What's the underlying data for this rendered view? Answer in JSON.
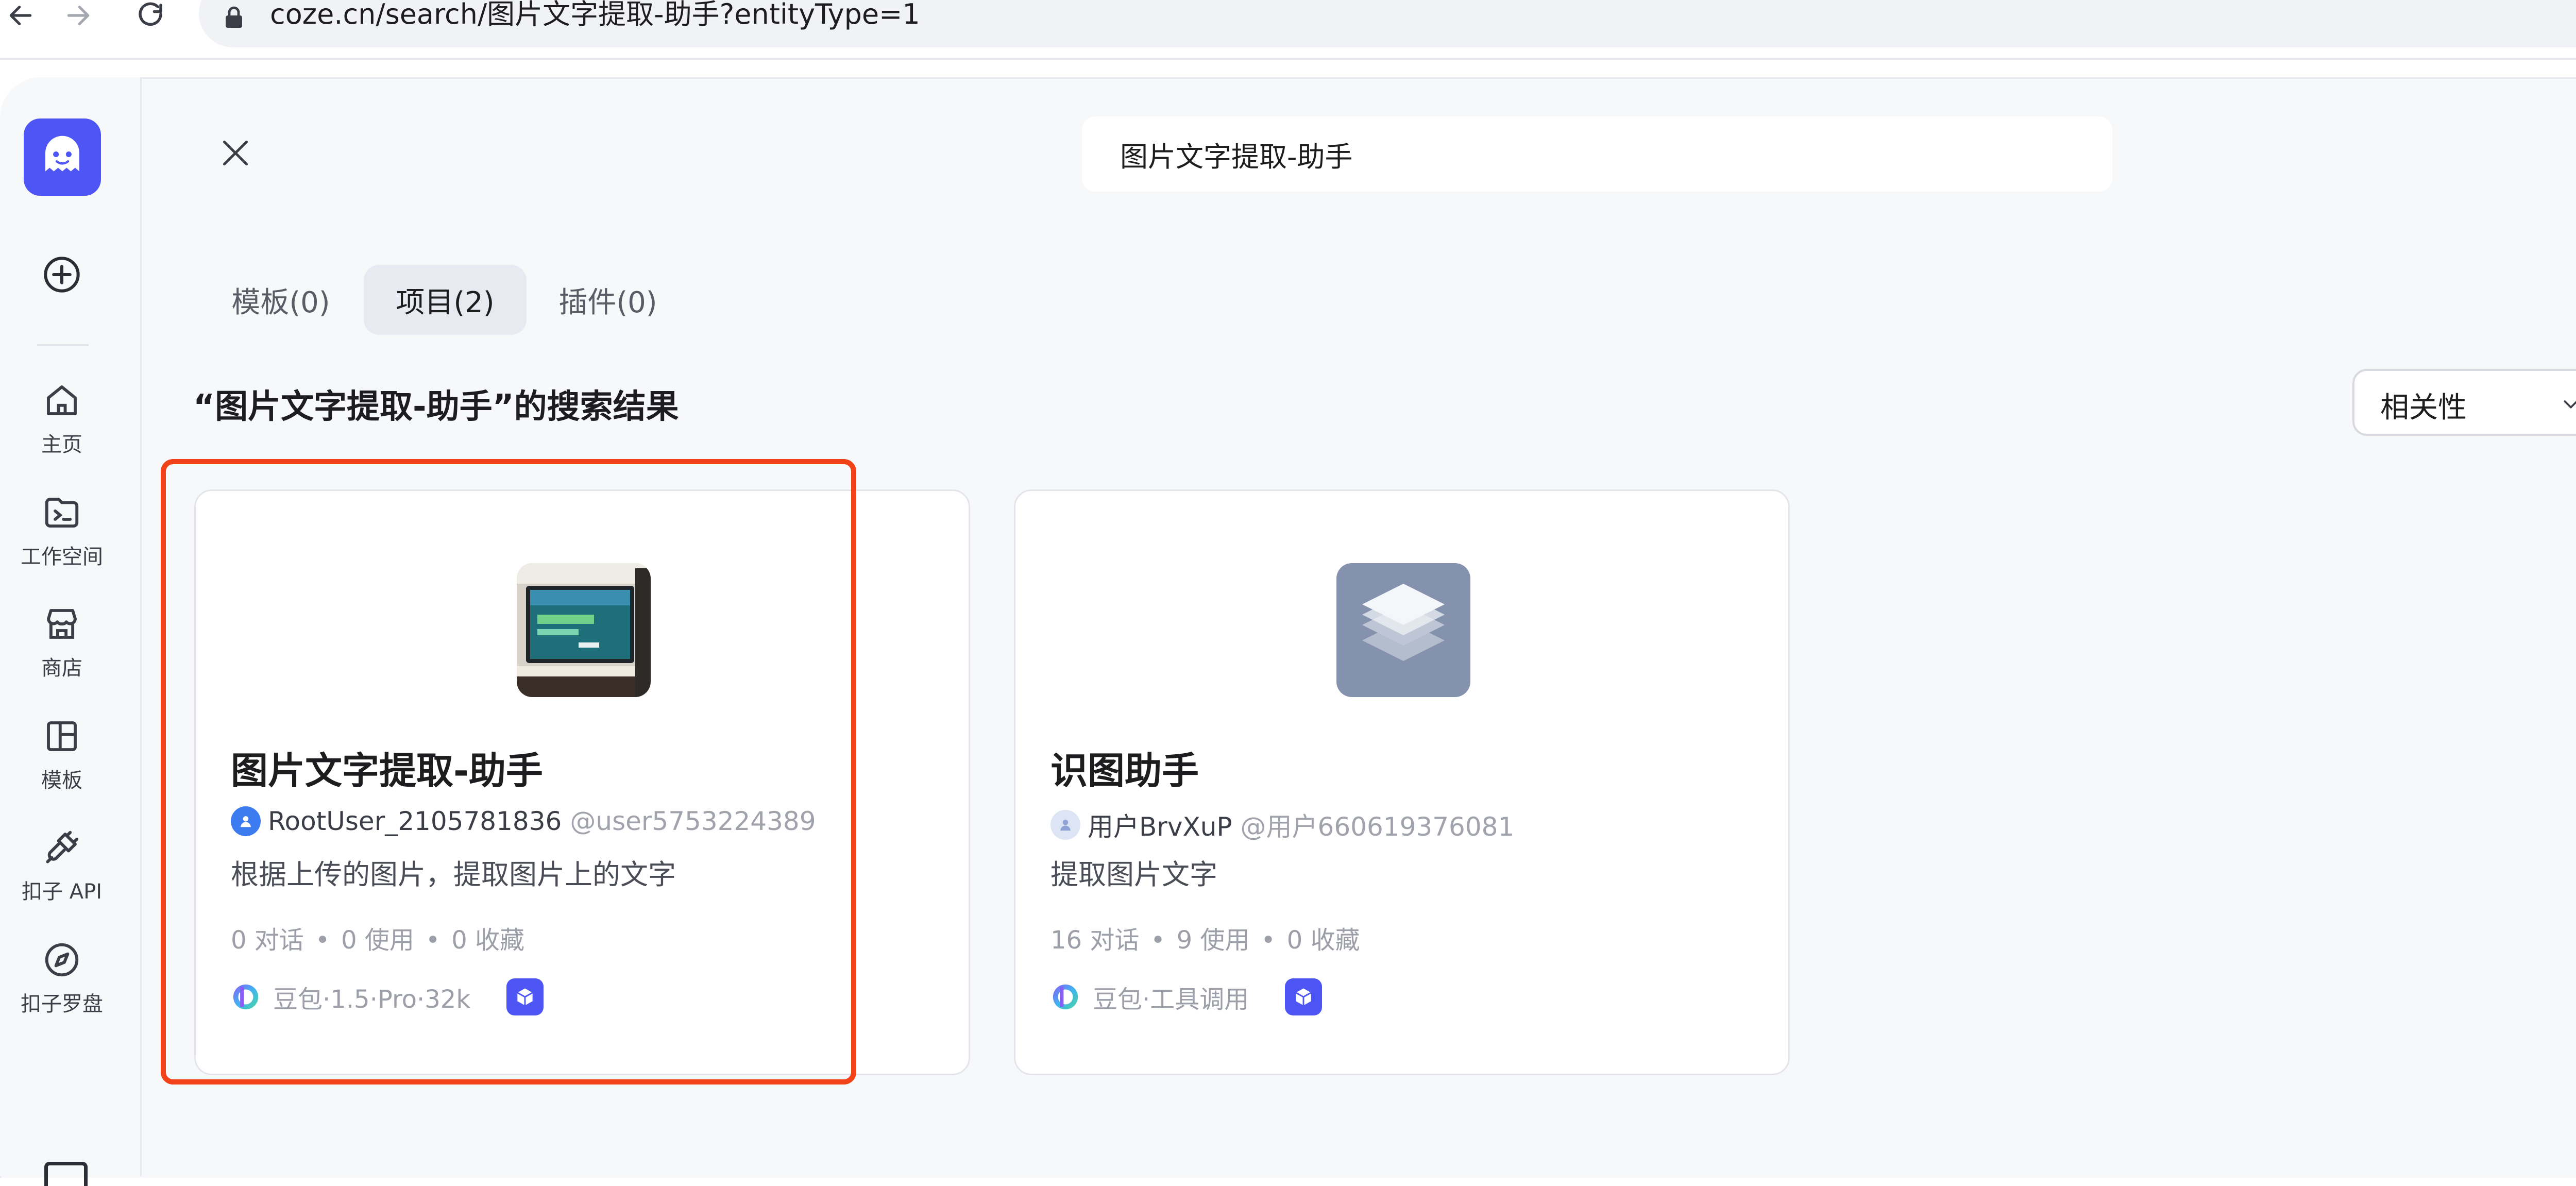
{
  "browser": {
    "url_domain": "coze.cn",
    "url_path": "/search/图片文字提取-助手?entityType=1"
  },
  "sidebar": {
    "items": [
      {
        "label": "主页",
        "icon": "home-icon"
      },
      {
        "label": "工作空间",
        "icon": "workspace-icon"
      },
      {
        "label": "商店",
        "icon": "store-icon"
      },
      {
        "label": "模板",
        "icon": "template-icon"
      },
      {
        "label": "扣子 API",
        "icon": "api-plug-icon"
      },
      {
        "label": "扣子罗盘",
        "icon": "compass-icon"
      }
    ]
  },
  "search": {
    "value": "图片文字提取-助手"
  },
  "tabs": [
    {
      "label": "模板(0)",
      "active": false
    },
    {
      "label": "项目(2)",
      "active": true
    },
    {
      "label": "插件(0)",
      "active": false
    }
  ],
  "results": {
    "title": "“图片文字提取-助手”的搜索结果",
    "sort_value": "相关性"
  },
  "cards": [
    {
      "name": "图片文字提取-助手",
      "author": "RootUser_2105781836",
      "handle": "@user5753224389",
      "description": "根据上传的图片，提取图片上的文字",
      "stats": [
        "0 对话",
        "0 使用",
        "0 收藏"
      ],
      "model": "豆包·1.5·Pro·32k",
      "highlighted": true
    },
    {
      "name": "识图助手",
      "author": "用户BrvXuP",
      "handle": "@用户660619376081",
      "description": "提取图片文字",
      "stats": [
        "16 对话",
        "9 使用",
        "0 收藏"
      ],
      "model": "豆包·工具调用",
      "highlighted": false
    }
  ],
  "colors": {
    "accent": "#4e55f5",
    "highlight": "#f14218",
    "background": "#f7f8fa"
  }
}
